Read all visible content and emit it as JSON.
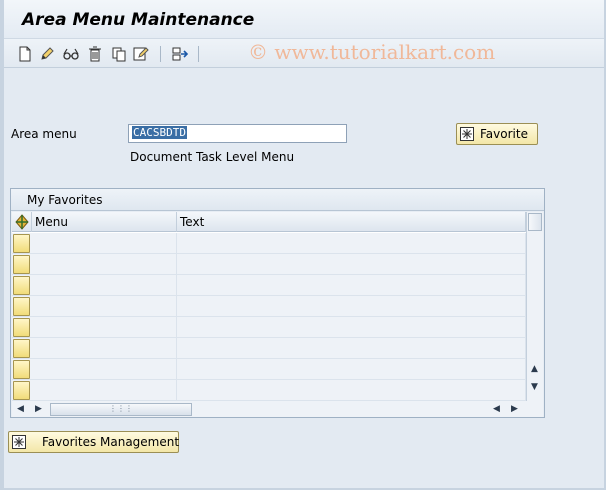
{
  "window": {
    "title": "Area Menu Maintenance"
  },
  "toolbar": {
    "buttons": [
      {
        "icon": "new-document-icon"
      },
      {
        "icon": "edit-pencil-icon"
      },
      {
        "icon": "display-glasses-icon"
      },
      {
        "icon": "delete-trash-icon"
      },
      {
        "icon": "copy-icon"
      },
      {
        "icon": "change-edit-icon"
      },
      {
        "icon": "transport-arrow-icon"
      }
    ]
  },
  "watermark": "© www.tutorialkart.com",
  "form": {
    "area_menu_label": "Area menu",
    "area_menu_value": "CACSBDTD",
    "description": "Document Task Level Menu",
    "favorite_button": "Favorite"
  },
  "favorites": {
    "title": "My Favorites",
    "columns": [
      "Menu",
      "Text"
    ],
    "rows": [
      {
        "menu": "",
        "text": ""
      },
      {
        "menu": "",
        "text": ""
      },
      {
        "menu": "",
        "text": ""
      },
      {
        "menu": "",
        "text": ""
      },
      {
        "menu": "",
        "text": ""
      },
      {
        "menu": "",
        "text": ""
      },
      {
        "menu": "",
        "text": ""
      },
      {
        "menu": "",
        "text": ""
      }
    ]
  },
  "favorites_management_button": "Favorites Management",
  "colors": {
    "accent_yellow": "#f3e7a8",
    "selection_blue": "#3a6ea5",
    "panel_bg": "#e3eaf2"
  }
}
